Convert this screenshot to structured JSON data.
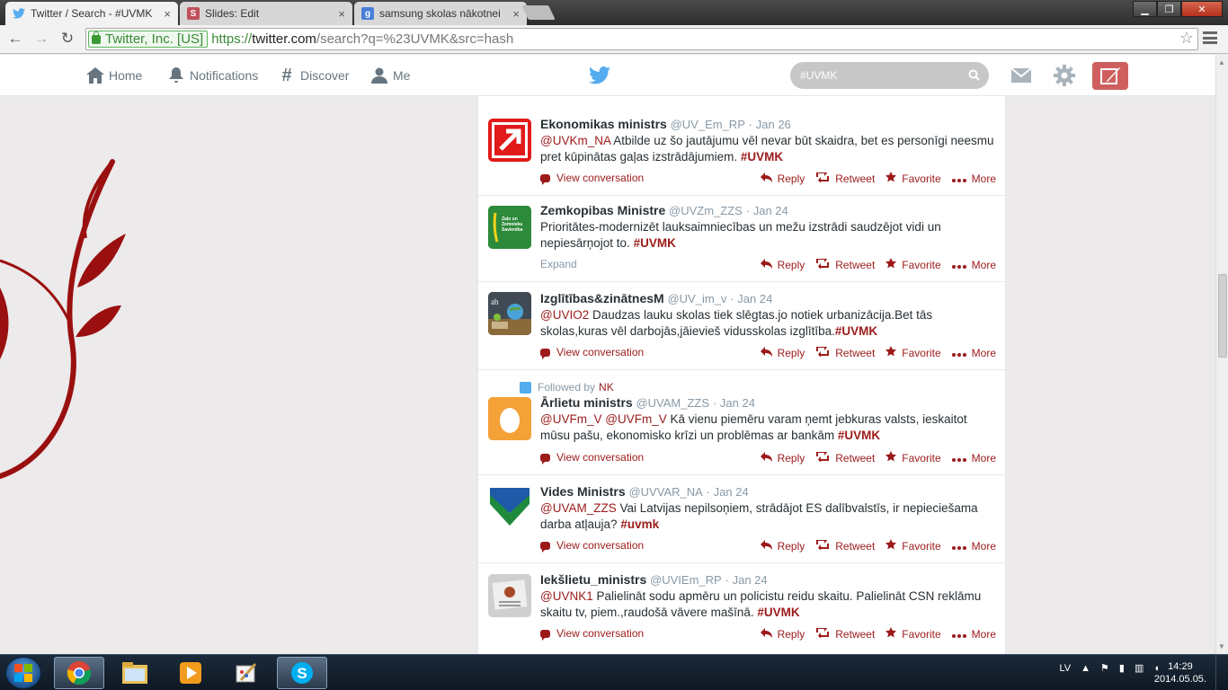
{
  "browser": {
    "tabs": [
      {
        "title": "Twitter / Search - #UVMK",
        "icon": "twitter-bird-icon",
        "active": true
      },
      {
        "title": "Slides: Edit",
        "icon": "slides-s-icon",
        "active": false
      },
      {
        "title": "samsung skolas nākotnei",
        "icon": "google-g-icon",
        "active": false
      }
    ],
    "close_glyph": "×",
    "security_label": "Twitter, Inc. [US]",
    "url_scheme": "https://",
    "url_host": "twitter.com",
    "url_rest": "/search?q=%23UVMK&src=hash"
  },
  "topbar": {
    "nav": [
      {
        "label": "Home",
        "icon": "home-icon"
      },
      {
        "label": "Notifications",
        "icon": "bell-icon"
      },
      {
        "label": "Discover",
        "icon": "hashtag-icon"
      },
      {
        "label": "Me",
        "icon": "person-icon"
      }
    ],
    "search_value": "#UVMK"
  },
  "tweets": [
    {
      "name": "Ekonomikas ministrs",
      "handle": "@UV_Em_RP",
      "date": "Jan 26",
      "parts": [
        {
          "t": "@UVKm_NA",
          "k": "m"
        },
        {
          "t": " Atbilde uz šo jautājumu vēl nevar būt skaidra, bet es personīgi neesmu pret kūpinātas gaļas izstrādājumiem. ",
          "k": ""
        },
        {
          "t": "#UVMK",
          "k": "h"
        }
      ],
      "left_action": "View conversation",
      "left_type": "conversation"
    },
    {
      "name": "Zemkopibas Ministre",
      "handle": "@UVZm_ZZS",
      "date": "Jan 24",
      "parts": [
        {
          "t": "Prioritātes-modernizēt lauksaimniecības un mežu izstrādi saudzējot vidi un nepiesārņojot to. ",
          "k": ""
        },
        {
          "t": "#UVMK",
          "k": "h"
        }
      ],
      "left_action": "Expand",
      "left_type": "expand",
      "avatar_text": "Zaļo un Zemnieku Savienība"
    },
    {
      "name": "Izglītības&zinātnesM",
      "handle": "@UV_im_v",
      "date": "Jan 24",
      "parts": [
        {
          "t": "@UVIO2",
          "k": "m"
        },
        {
          "t": " Daudzas lauku skolas tiek slēgtas.jo notiek urbanizācija.Bet tās skolas,kuras vēl darbojās,jāievieš vidusskolas izglītība.",
          "k": ""
        },
        {
          "t": "#UVMK",
          "k": "h"
        }
      ],
      "left_action": "View conversation",
      "left_type": "conversation"
    },
    {
      "context_label": "Followed by",
      "context_name": "NK",
      "name": "Ārlietu ministrs",
      "handle": "@UVAM_ZZS",
      "date": "Jan 24",
      "parts": [
        {
          "t": "@UVFm_V",
          "k": "m"
        },
        {
          "t": " ",
          "k": ""
        },
        {
          "t": "@UVFm_V",
          "k": "m"
        },
        {
          "t": " Kā vienu piemēru varam ņemt jebkuras valsts, ieskaitot mūsu pašu, ekonomisko krīzi un problēmas ar bankām ",
          "k": ""
        },
        {
          "t": "#UVMK",
          "k": "h"
        }
      ],
      "left_action": "View conversation",
      "left_type": "conversation"
    },
    {
      "name": "Vides Ministrs",
      "handle": "@UVVAR_NA",
      "date": "Jan 24",
      "parts": [
        {
          "t": "@UVAM_ZZS",
          "k": "m"
        },
        {
          "t": " Vai Latvijas nepilsoņiem, strādājot ES dalībvalstīs, ir nepieciešama darba atļauja? ",
          "k": ""
        },
        {
          "t": "#uvmk",
          "k": "h"
        }
      ],
      "left_action": "View conversation",
      "left_type": "conversation"
    },
    {
      "name": "Iekšlietu_ministrs",
      "handle": "@UVIEm_RP",
      "date": "Jan 24",
      "parts": [
        {
          "t": "@UVNK1",
          "k": "m"
        },
        {
          "t": " Palielināt sodu apmēru un policistu reidu skaitu. Palielināt CSN reklāmu skaitu tv, piem.,raudošā vāvere mašīnā. ",
          "k": ""
        },
        {
          "t": "#UVMK",
          "k": "h"
        }
      ],
      "left_action": "View conversation",
      "left_type": "conversation"
    }
  ],
  "tweet_actions": {
    "reply": "Reply",
    "retweet": "Retweet",
    "favorite": "Favorite",
    "more": "More"
  },
  "taskbar": {
    "apps": [
      "chrome-icon",
      "explorer-icon",
      "media-player-icon",
      "paint-icon",
      "skype-icon"
    ],
    "language": "LV",
    "time": "14:29",
    "date": "2014.05.05."
  },
  "colors": {
    "accent": "#9c1a1a",
    "link": "#9c1a1a",
    "compose": "#cf5f5f"
  }
}
